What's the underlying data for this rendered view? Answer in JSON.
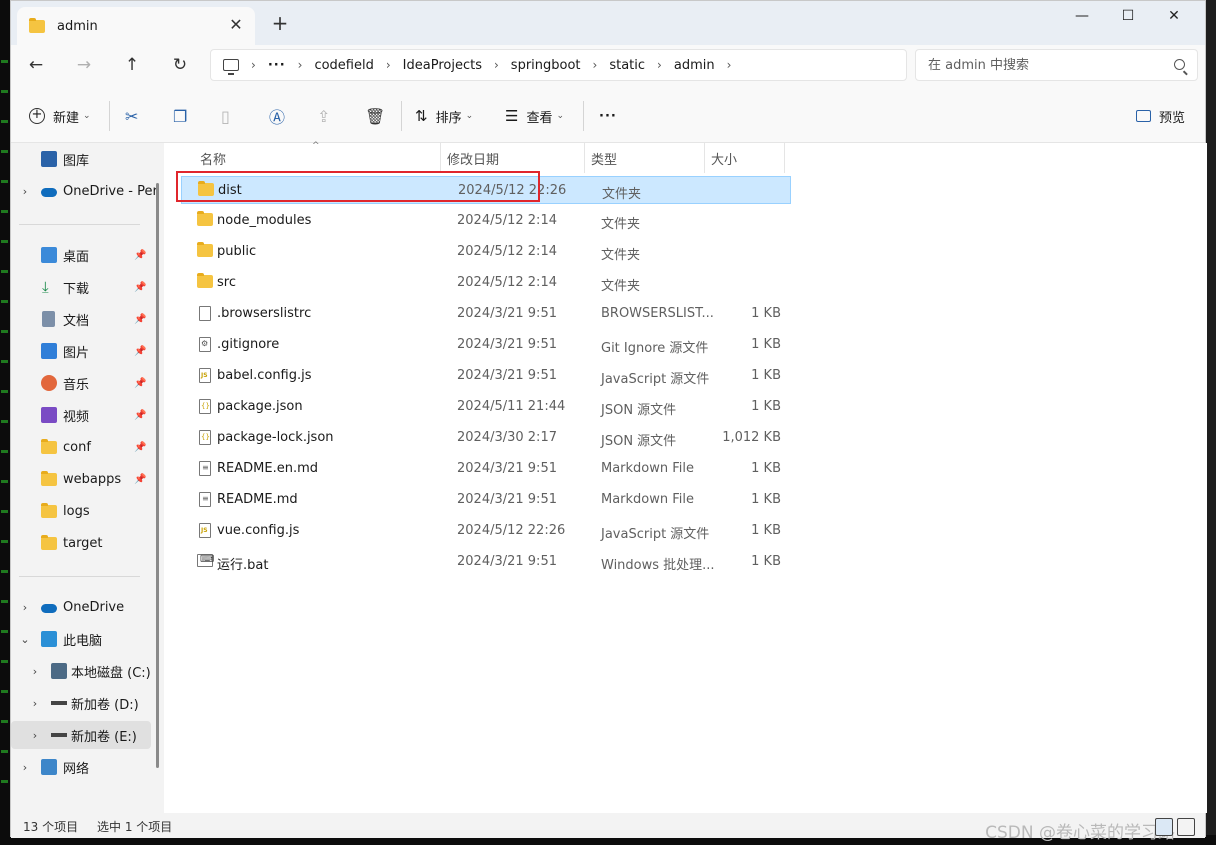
{
  "tab": {
    "title": "admin"
  },
  "address": {
    "dots": "···",
    "crumbs": [
      "codefield",
      "IdeaProjects",
      "springboot",
      "static",
      "admin"
    ]
  },
  "search": {
    "placeholder": "在 admin 中搜索"
  },
  "toolbar": {
    "new_label": "新建",
    "sort_label": "排序",
    "view_label": "查看",
    "more_label": "···",
    "preview_label": "预览"
  },
  "sidebar": {
    "top": [
      {
        "label": "图库",
        "icon": "gallery-icon"
      },
      {
        "label": "OneDrive - Per",
        "icon": "onedrive-icon"
      }
    ],
    "quick": [
      {
        "label": "桌面",
        "icon": "desktop-icon"
      },
      {
        "label": "下载",
        "icon": "download-icon"
      },
      {
        "label": "文档",
        "icon": "documents-icon"
      },
      {
        "label": "图片",
        "icon": "pictures-icon"
      },
      {
        "label": "音乐",
        "icon": "music-icon"
      },
      {
        "label": "视频",
        "icon": "video-icon"
      },
      {
        "label": "conf",
        "icon": "folder-icon"
      },
      {
        "label": "webapps",
        "icon": "folder-icon"
      },
      {
        "label": "logs",
        "icon": "folder-icon"
      },
      {
        "label": "target",
        "icon": "folder-icon"
      }
    ],
    "bottom": [
      {
        "label": "OneDrive",
        "icon": "onedrive-icon"
      },
      {
        "label": "此电脑",
        "icon": "this-pc-icon"
      },
      {
        "label": "本地磁盘 (C:)",
        "icon": "drive-icon"
      },
      {
        "label": "新加卷 (D:)",
        "icon": "drive-icon"
      },
      {
        "label": "新加卷 (E:)",
        "icon": "drive-icon"
      },
      {
        "label": "网络",
        "icon": "network-icon"
      }
    ]
  },
  "columns": {
    "name": "名称",
    "date": "修改日期",
    "type": "类型",
    "size": "大小"
  },
  "files": [
    {
      "name": "dist",
      "date": "2024/5/12 22:26",
      "type": "文件夹",
      "size": "",
      "kind": "folder"
    },
    {
      "name": "node_modules",
      "date": "2024/5/12 2:14",
      "type": "文件夹",
      "size": "",
      "kind": "folder"
    },
    {
      "name": "public",
      "date": "2024/5/12 2:14",
      "type": "文件夹",
      "size": "",
      "kind": "folder"
    },
    {
      "name": "src",
      "date": "2024/5/12 2:14",
      "type": "文件夹",
      "size": "",
      "kind": "folder"
    },
    {
      "name": ".browserslistrc",
      "date": "2024/3/21 9:51",
      "type": "BROWSERSLIST...",
      "size": "1 KB",
      "kind": "file"
    },
    {
      "name": ".gitignore",
      "date": "2024/3/21 9:51",
      "type": "Git Ignore 源文件",
      "size": "1 KB",
      "kind": "git"
    },
    {
      "name": "babel.config.js",
      "date": "2024/3/21 9:51",
      "type": "JavaScript 源文件",
      "size": "1 KB",
      "kind": "js"
    },
    {
      "name": "package.json",
      "date": "2024/5/11 21:44",
      "type": "JSON 源文件",
      "size": "1 KB",
      "kind": "json"
    },
    {
      "name": "package-lock.json",
      "date": "2024/3/30 2:17",
      "type": "JSON 源文件",
      "size": "1,012 KB",
      "kind": "json"
    },
    {
      "name": "README.en.md",
      "date": "2024/3/21 9:51",
      "type": "Markdown File",
      "size": "1 KB",
      "kind": "md"
    },
    {
      "name": "README.md",
      "date": "2024/3/21 9:51",
      "type": "Markdown File",
      "size": "1 KB",
      "kind": "md"
    },
    {
      "name": "vue.config.js",
      "date": "2024/5/12 22:26",
      "type": "JavaScript 源文件",
      "size": "1 KB",
      "kind": "js"
    },
    {
      "name": "运行.bat",
      "date": "2024/3/21 9:51",
      "type": "Windows 批处理...",
      "size": "1 KB",
      "kind": "bat"
    }
  ],
  "status": {
    "count": "13 个项目",
    "selected": "选中 1 个项目"
  },
  "watermark": "CSDN @卷心菜的学习路"
}
